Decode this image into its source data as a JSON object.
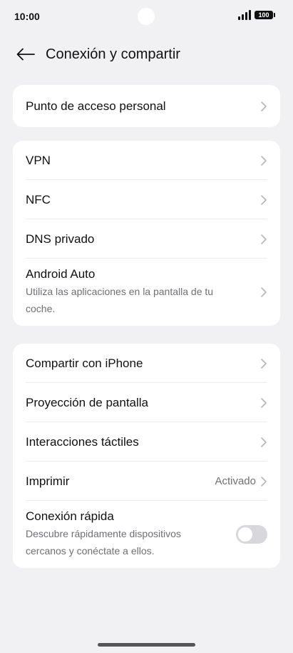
{
  "status": {
    "time": "10:00",
    "battery": "100"
  },
  "header": {
    "title": "Conexión y compartir",
    "back_icon": "back-arrow-icon"
  },
  "group1": [
    {
      "title": "Punto de acceso personal"
    }
  ],
  "group2": [
    {
      "title": "VPN"
    },
    {
      "title": "NFC"
    },
    {
      "title": "DNS privado"
    },
    {
      "title": "Android Auto",
      "subtitle": "Utiliza las aplicaciones en la pantalla de tu coche."
    }
  ],
  "group3": [
    {
      "title": "Compartir con iPhone"
    },
    {
      "title": "Proyección de pantalla"
    },
    {
      "title": "Interacciones táctiles"
    },
    {
      "title": "Imprimir",
      "value": "Activado"
    },
    {
      "title": "Conexión rápida",
      "subtitle": "Descubre rápidamente dispositivos cercanos y conéctate a ellos.",
      "toggle_on": false
    }
  ]
}
